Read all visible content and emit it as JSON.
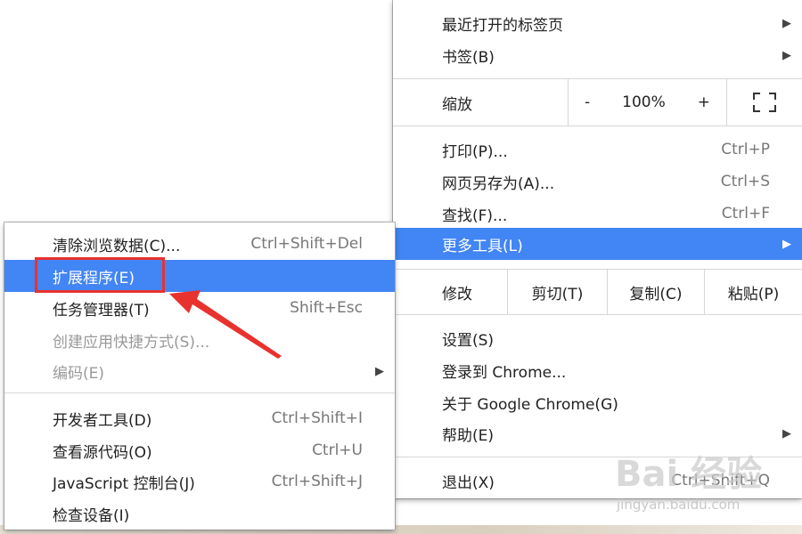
{
  "main_menu": {
    "recent_tabs": "最近打开的标签页",
    "bookmarks": "书签(B)",
    "zoom_label": "缩放",
    "zoom_minus": "-",
    "zoom_value": "100%",
    "zoom_plus": "+",
    "print": "打印(P)...",
    "print_shortcut": "Ctrl+P",
    "save_page": "网页另存为(A)...",
    "save_page_shortcut": "Ctrl+S",
    "find": "查找(F)...",
    "find_shortcut": "Ctrl+F",
    "more_tools": "更多工具(L)",
    "edit_label": "修改",
    "cut": "剪切(T)",
    "copy": "复制(C)",
    "paste": "粘贴(P)",
    "settings": "设置(S)",
    "sign_in": "登录到 Chrome...",
    "about": "关于 Google Chrome(G)",
    "help": "帮助(E)",
    "exit": "退出(X)",
    "exit_shortcut": "Ctrl+Shift+Q"
  },
  "sub_menu": {
    "clear_data": "清除浏览数据(C)...",
    "clear_data_shortcut": "Ctrl+Shift+Del",
    "extensions": "扩展程序(E)",
    "task_manager": "任务管理器(T)",
    "task_manager_shortcut": "Shift+Esc",
    "create_shortcut": "创建应用快捷方式(S)...",
    "encoding": "编码(E)",
    "dev_tools": "开发者工具(D)",
    "dev_tools_shortcut": "Ctrl+Shift+I",
    "view_source": "查看源代码(O)",
    "view_source_shortcut": "Ctrl+U",
    "js_console": "JavaScript 控制台(J)",
    "js_console_shortcut": "Ctrl+Shift+J",
    "inspect_devices": "检查设备(I)"
  },
  "watermark": {
    "brand": "Bai 经验",
    "url": "jingyan.baidu.com"
  },
  "colors": {
    "highlight": "#4285f4",
    "annotation": "#e8322e"
  }
}
